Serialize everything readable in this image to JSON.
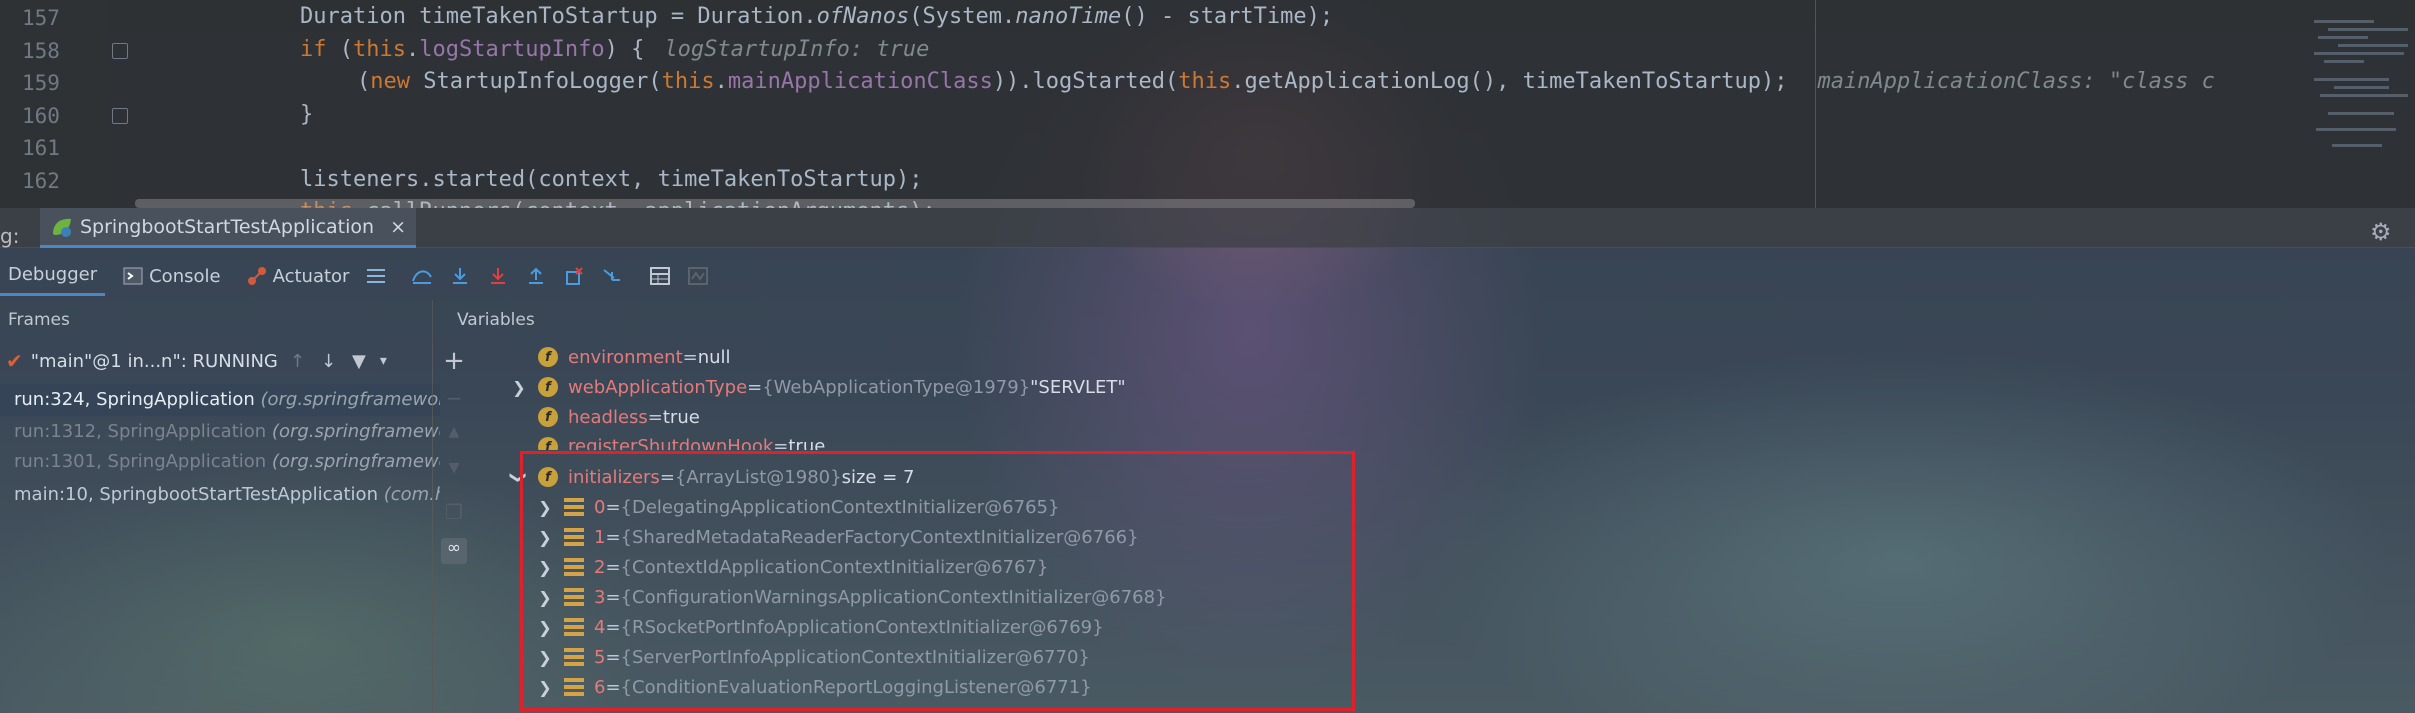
{
  "editor": {
    "lines": [
      {
        "num": "157"
      },
      {
        "num": "158"
      },
      {
        "num": "159"
      },
      {
        "num": "160"
      },
      {
        "num": "161"
      },
      {
        "num": "162"
      }
    ],
    "code157": {
      "a": "Duration timeTakenToStartup = Duration.",
      "b": "ofNanos",
      "c": "(System.",
      "d": "nanoTime",
      "e": "() - startTime);"
    },
    "code158": {
      "a": "if",
      "b": " (",
      "c": "this",
      "d": ".",
      "e": "logStartupInfo",
      "f": ") {",
      "hint": "logStartupInfo: true"
    },
    "code159": {
      "a": "(",
      "b": "new",
      "c": " StartupInfoLogger(",
      "d": "this",
      "e": ".",
      "f": "mainApplicationClass",
      "g": ")).logStarted(",
      "h": "this",
      "i": ".getApplicationLog(), timeTakenToStartup);",
      "hint": "mainApplicationClass: \"class c"
    },
    "code160": "}",
    "code162": {
      "a": "listeners.started(context, timeTakenToStartup);"
    },
    "code163": {
      "a": "this",
      "b": ".callRunners(context, applicationArguments);"
    }
  },
  "debug": {
    "label": "g:",
    "run_tab": "SpringbootStartTestApplication",
    "close": "×"
  },
  "toolbar": {
    "debugger": "Debugger",
    "console": "Console",
    "actuator": "Actuator"
  },
  "frames": {
    "title": "Frames",
    "thread": "\"main\"@1 in...n\": RUNNING",
    "items": [
      {
        "method": "run:324, SpringApplication ",
        "pkg": "(org.springframework"
      },
      {
        "method": "run:1312, SpringApplication ",
        "pkg": "(org.springframewo"
      },
      {
        "method": "run:1301, SpringApplication ",
        "pkg": "(org.springframewo"
      },
      {
        "method": "main:10, SpringbootStartTestApplication ",
        "pkg": "(com.h"
      }
    ]
  },
  "variables": {
    "title": "Variables",
    "env": {
      "name": "environment",
      "eq": " = ",
      "val": "null"
    },
    "webtype": {
      "name": "webApplicationType",
      "eq": " = ",
      "ref": "{WebApplicationType@1979} ",
      "val": "\"SERVLET\""
    },
    "headless": {
      "name": "headless",
      "eq": " = ",
      "val": "true"
    },
    "shutdown": {
      "name": "registerShutdownHook",
      "eq": " = ",
      "val": "true"
    },
    "initializers": {
      "name": "initializers",
      "eq": " = ",
      "ref": "{ArrayList@1980} ",
      "val": " size = 7"
    },
    "items": [
      {
        "idx": "0",
        "eq": " = ",
        "ref": "{DelegatingApplicationContextInitializer@6765}"
      },
      {
        "idx": "1",
        "eq": " = ",
        "ref": "{SharedMetadataReaderFactoryContextInitializer@6766}"
      },
      {
        "idx": "2",
        "eq": " = ",
        "ref": "{ContextIdApplicationContextInitializer@6767}"
      },
      {
        "idx": "3",
        "eq": " = ",
        "ref": "{ConfigurationWarningsApplicationContextInitializer@6768}"
      },
      {
        "idx": "4",
        "eq": " = ",
        "ref": "{RSocketPortInfoApplicationContextInitializer@6769}"
      },
      {
        "idx": "5",
        "eq": " = ",
        "ref": "{ServerPortInfoApplicationContextInitializer@6770}"
      },
      {
        "idx": "6",
        "eq": " = ",
        "ref": "{ConditionEvaluationReportLoggingListener@6771}"
      }
    ]
  },
  "colors": {
    "highlight_box": "#e0202a",
    "accent": "#4a88c7"
  }
}
